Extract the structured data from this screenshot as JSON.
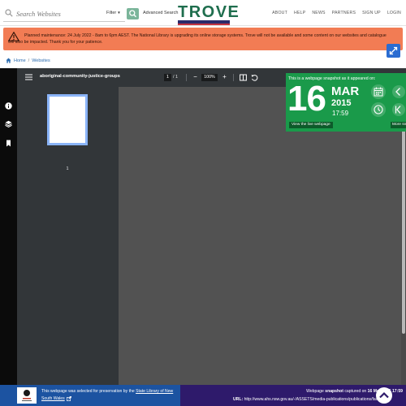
{
  "header": {
    "search_placeholder": "Search Websites",
    "filter_label": "Filter",
    "advanced_search_label": "Advanced Search",
    "logo_text": "TROVE",
    "nav": [
      "ABOUT",
      "HELP",
      "NEWS",
      "PARTNERS",
      "SIGN UP",
      "LOGIN"
    ]
  },
  "alert": {
    "text": "Planned maintenance: 24 July 2022 - 8am to 6pm AEST. The National Library is upgrading its online storage systems. Trove will not be available and some content on our websites and catalogue will also be impacted. Thank you for your patience."
  },
  "breadcrumb": {
    "home": "Home",
    "separator": "/",
    "current": "Websites"
  },
  "pdf_viewer": {
    "title": "aboriginal-community-justice-groups",
    "current_page": "1",
    "page_of": "/  1",
    "zoom": "100%",
    "zoom_out": "−",
    "zoom_in": "+",
    "thumbnail_label": "1"
  },
  "snapshot": {
    "heading": "This is a webpage snapshot as it appeared on:",
    "day": "16",
    "month": "MAR",
    "year": "2015",
    "time": "17:59",
    "view_live_label": "View the live webpage",
    "more_label": "More sn"
  },
  "footer": {
    "preservation_prefix": "This webpage was selected for preservation by the",
    "library_link": "State Library of New South Wales",
    "snapshot_prefix": "Webpage",
    "snapshot_word": "snapshot",
    "snapshot_middle": "captured on",
    "snapshot_date": "16 Mar 2015 17:59",
    "url_label": "URL:",
    "url": "http://www.ahs.nsw.gov.au/-/ASSETS/media-publications/publications/factsheets"
  },
  "colors": {
    "brand_green": "#1a9a4a",
    "alert_orange": "#f27c54",
    "footer_blue": "#1c53a1",
    "footer_purple": "#2e1a6b",
    "link_blue": "#2b6cb0"
  },
  "icons": [
    "search-icon",
    "chevron-down-icon",
    "warning-icon",
    "expand-icon",
    "home-icon",
    "info-icon",
    "layers-icon",
    "bookmark-icon",
    "menu-icon",
    "fit-page-icon",
    "rotate-icon",
    "calendar-icon",
    "clock-icon",
    "chevron-left-icon",
    "first-page-icon",
    "external-link-icon",
    "arrow-up-icon"
  ]
}
